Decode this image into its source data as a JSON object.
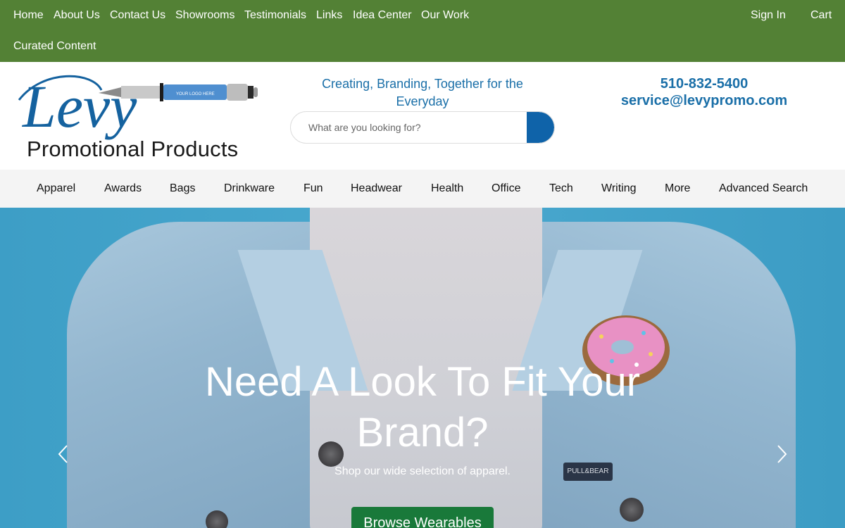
{
  "topnav": {
    "items": [
      "Home",
      "About Us",
      "Contact Us",
      "Showrooms",
      "Testimonials",
      "Links",
      "Idea Center",
      "Our Work"
    ],
    "second_row": [
      "Curated Content"
    ],
    "right": [
      "Sign In",
      "Cart"
    ]
  },
  "logo": {
    "script_text": "Levy",
    "subtitle": "Promotional Products",
    "pen_text": "YOUR LOGO HERE"
  },
  "header": {
    "tagline": "Creating, Branding, Together for the Everyday",
    "phone": "510-832-5400",
    "email": "service@levypromo.com"
  },
  "search": {
    "placeholder": "What are you looking for?"
  },
  "categories": [
    "Apparel",
    "Awards",
    "Bags",
    "Drinkware",
    "Fun",
    "Headwear",
    "Health",
    "Office",
    "Tech",
    "Writing",
    "More",
    "Advanced Search"
  ],
  "hero": {
    "headline": "Need A Look To Fit Your Brand?",
    "subline": "Shop our wide selection of apparel.",
    "cta_label": "Browse Wearables",
    "patch_text": "PULL&BEAR"
  },
  "colors": {
    "topbar": "#538135",
    "brand_blue": "#1a6fa8",
    "search_button": "#0f63a9",
    "cta": "#19793a",
    "category_bar": "#f4f4f4"
  },
  "icons": [
    "search-icon",
    "chevron-left-icon",
    "chevron-right-icon"
  ]
}
